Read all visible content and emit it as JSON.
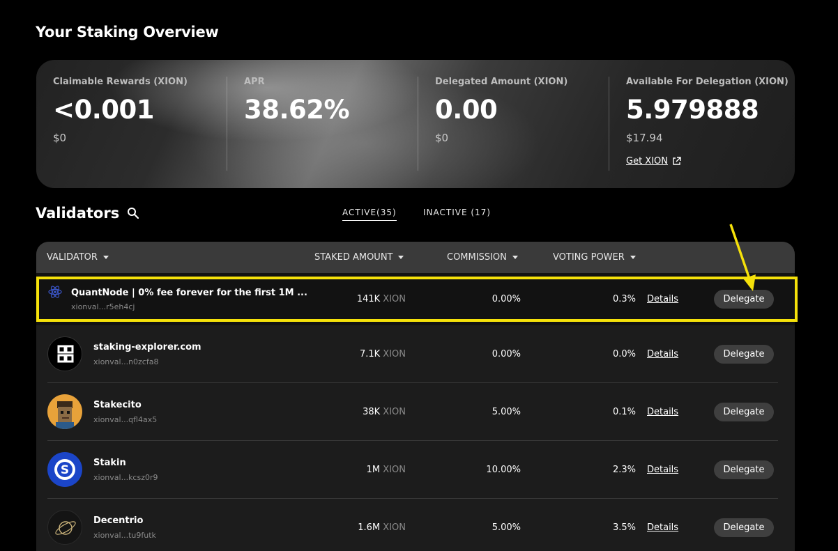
{
  "page": {
    "title": "Your Staking Overview"
  },
  "overview": {
    "stats": [
      {
        "label": "Claimable Rewards (XION)",
        "value": "<0.001",
        "sub": "$0"
      },
      {
        "label": "APR",
        "value": "38.62%",
        "sub": ""
      },
      {
        "label": "Delegated Amount (XION)",
        "value": "0.00",
        "sub": "$0"
      },
      {
        "label": "Available For Delegation (XION)",
        "value": "5.979888",
        "sub": "$17.94"
      }
    ],
    "get_link": "Get XION"
  },
  "validators": {
    "title": "Validators",
    "tabs": [
      {
        "label": "ACTIVE(35)",
        "active": true
      },
      {
        "label": "INACTIVE (17)",
        "active": false
      }
    ],
    "columns": {
      "validator": "VALIDATOR",
      "staked": "STAKED AMOUNT",
      "commission": "COMMISSION",
      "voting": "VOTING POWER"
    },
    "rows": [
      {
        "name": "QuantNode | 0% fee forever for the first 1M ...",
        "address": "xionval...r5eh4cj",
        "staked": "141K",
        "unit": "XION",
        "commission": "0.00%",
        "voting": "0.3%",
        "details": "Details",
        "delegate": "Delegate",
        "highlighted": true
      },
      {
        "name": "staking-explorer.com",
        "address": "xionval...n0zcfa8",
        "staked": "7.1K",
        "unit": "XION",
        "commission": "0.00%",
        "voting": "0.0%",
        "details": "Details",
        "delegate": "Delegate"
      },
      {
        "name": "Stakecito",
        "address": "xionval...qfl4ax5",
        "staked": "38K",
        "unit": "XION",
        "commission": "5.00%",
        "voting": "0.1%",
        "details": "Details",
        "delegate": "Delegate"
      },
      {
        "name": "Stakin",
        "address": "xionval...kcsz0r9",
        "staked": "1M",
        "unit": "XION",
        "commission": "10.00%",
        "voting": "2.3%",
        "details": "Details",
        "delegate": "Delegate"
      },
      {
        "name": "Decentrio",
        "address": "xionval...tu9futk",
        "staked": "1.6M",
        "unit": "XION",
        "commission": "5.00%",
        "voting": "3.5%",
        "details": "Details",
        "delegate": "Delegate"
      }
    ]
  },
  "colors": {
    "highlight": "#f5e10a",
    "background": "#000000",
    "card": "#1c1c1c"
  }
}
